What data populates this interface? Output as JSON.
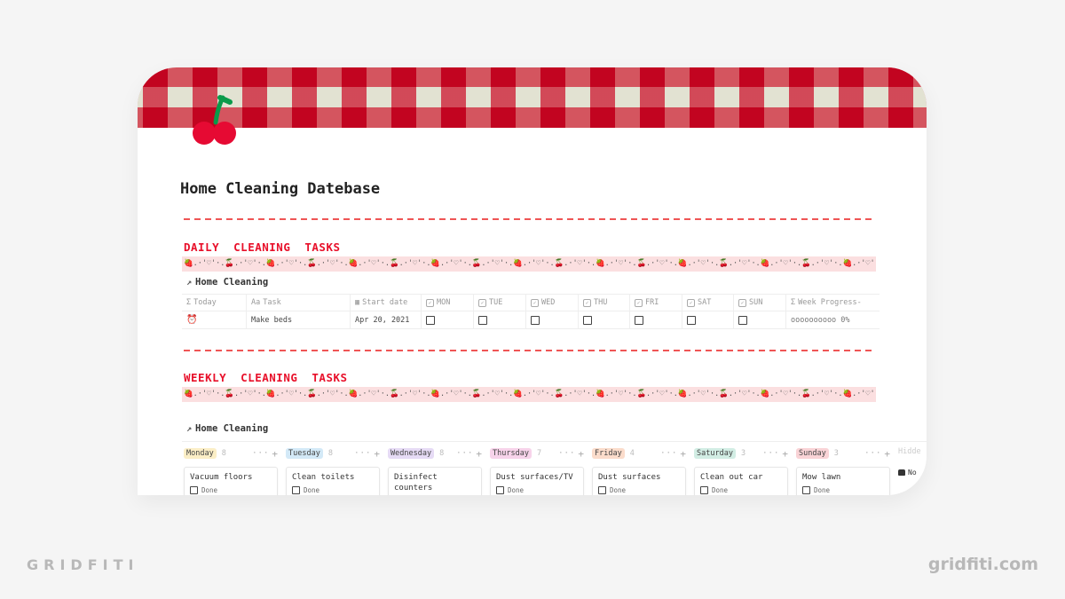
{
  "page": {
    "title": "Home Cleaning Datebase",
    "cover_icon": "cherry-icon"
  },
  "colors": {
    "accent_red": "#e8102a",
    "gingham_dark": "#c1001c",
    "gingham_cream": "#e3e6d8",
    "deco_band": "#fbdfe0",
    "background": "#f5f5f5"
  },
  "daily": {
    "heading": "DAILY CLEANING TASKS",
    "decoration": "🍓.·'♡'·.🍒.·'♡'·.🍓.·'♡'·.🍒.·'♡'·.🍓.·'♡'·.🍒.·'♡'·.🍓.·'♡'·.🍒.·'♡'·.🍓.·'♡'·.🍒.·'♡'·.🍓.·'♡'·.🍒.·'♡'·.🍓.·'♡'·.🍒.·'♡'·.🍓.·'♡'·.🍒.·'♡'·.🍓.·'♡'·.🍒.·'♡'·.🍓.·'♡'·.🍒.·'♡'·.🍓.·'♡'·.🍒.·'♡'·.🍓.·'♡'",
    "linked_db": "Home Cleaning",
    "columns": [
      {
        "icon": "Σ",
        "label": "Today"
      },
      {
        "icon": "Aa",
        "label": "Task"
      },
      {
        "icon": "📅",
        "label": "Start date"
      },
      {
        "icon": "☑",
        "label": "MON"
      },
      {
        "icon": "☑",
        "label": "TUE"
      },
      {
        "icon": "☑",
        "label": "WED"
      },
      {
        "icon": "☑",
        "label": "THU"
      },
      {
        "icon": "☑",
        "label": "FRI"
      },
      {
        "icon": "☑",
        "label": "SAT"
      },
      {
        "icon": "☑",
        "label": "SUN"
      },
      {
        "icon": "Σ",
        "label": "Week Progress-"
      }
    ],
    "rows": [
      {
        "today": "⏰",
        "task": "Make beds",
        "start_date": "Apr 20, 2021",
        "mon": false,
        "tue": false,
        "wed": false,
        "thu": false,
        "fri": false,
        "sat": false,
        "sun": false,
        "progress_text": "oooooooooo 0%",
        "progress_percent": 0
      }
    ]
  },
  "weekly": {
    "heading": "WEEKLY CLEANING TASKS",
    "decoration": "🍓.·'♡'·.🍒.·'♡'·.🍓.·'♡'·.🍒.·'♡'·.🍓.·'♡'·.🍒.·'♡'·.🍓.·'♡'·.🍒.·'♡'·.🍓.·'♡'·.🍒.·'♡'·.🍓.·'♡'·.🍒.·'♡'·.🍓.·'♡'·.🍒.·'♡'·.🍓.·'♡'·.🍒.·'♡'·.🍓.·'♡'·.🍒.·'♡'·.🍓.·'♡'·.🍒.·'♡'·.🍓.·'♡'·.🍒.·'♡'·.🍓.·'♡'",
    "linked_db": "Home Cleaning",
    "board": [
      {
        "day": "Monday",
        "count": "8",
        "color": "#fbeec6",
        "card": "Vacuum floors",
        "done_label": "Done"
      },
      {
        "day": "Tuesday",
        "count": "8",
        "color": "#d3e9f7",
        "card": "Clean toilets",
        "done_label": "Done"
      },
      {
        "day": "Wednesday",
        "count": "8",
        "color": "#e6dbf5",
        "card": "Disinfect counters",
        "done_label": ""
      },
      {
        "day": "Thursday",
        "count": "7",
        "color": "#f7d3ea",
        "card": "Dust surfaces/TV",
        "done_label": "Done"
      },
      {
        "day": "Friday",
        "count": "4",
        "color": "#fbdccb",
        "card": "Dust surfaces",
        "done_label": "Done"
      },
      {
        "day": "Saturday",
        "count": "3",
        "color": "#d2ede4",
        "card": "Clean out car",
        "done_label": "Done"
      },
      {
        "day": "Sunday",
        "count": "3",
        "color": "#f9d3d6",
        "card": "Mow lawn",
        "done_label": "Done"
      }
    ],
    "hidden_label": "Hidde",
    "hidden_item": "No",
    "ops_label": "···",
    "add_label": "+"
  },
  "branding": {
    "left": "GRIDFITI",
    "right": "gridfiti.com"
  }
}
